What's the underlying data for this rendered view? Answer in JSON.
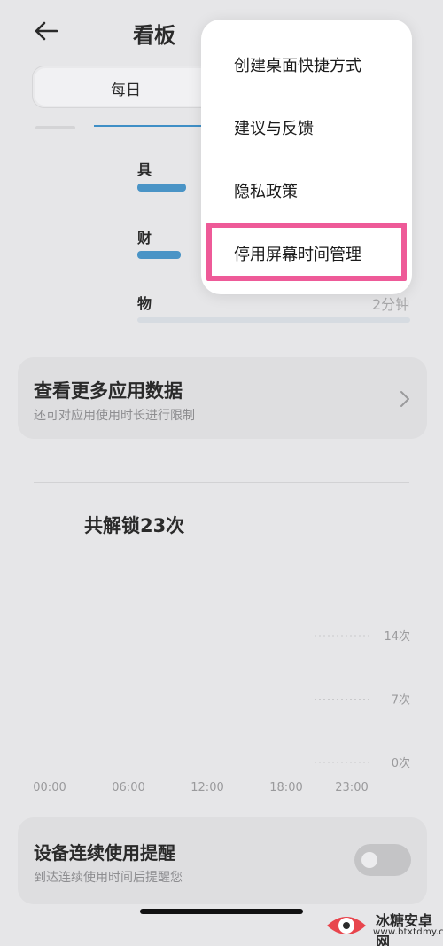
{
  "header": {
    "title": "看板"
  },
  "tabs": {
    "active_label": "每日"
  },
  "apps": [
    {
      "label": "具",
      "bar_fraction": 0.18
    },
    {
      "label": "财",
      "bar_fraction": 0.16
    },
    {
      "label": "物",
      "usage": "2分钟",
      "bar_fraction": 0.01
    }
  ],
  "more_data_card": {
    "title": "查看更多应用数据",
    "subtitle": "还可对应用使用时长进行限制"
  },
  "unlocks": {
    "summary": "共解锁23次"
  },
  "chart_data": {
    "type": "bar",
    "x_ticks": [
      "00:00",
      "06:00",
      "12:00",
      "18:00",
      "23:00"
    ],
    "y_ticks": [
      "14次",
      "7次",
      "0次"
    ],
    "y_tick_values": [
      14,
      7,
      0
    ],
    "ylim": [
      0,
      14
    ],
    "series": [],
    "grid": true
  },
  "reminder_card": {
    "title": "设备连续使用提醒",
    "subtitle": "到达连续使用时间后提醒您",
    "enabled": false
  },
  "menu": {
    "items": [
      "创建桌面快捷方式",
      "建议与反馈",
      "隐私政策",
      "停用屏幕时间管理"
    ],
    "highlighted_index": 3,
    "highlight_color": "#ee5a98"
  },
  "watermark": {
    "name": "冰糖安卓网",
    "url": "www.btxtdmy.com"
  },
  "colors": {
    "accent": "#4a94c6",
    "background": "#e6e6e8",
    "menu_background": "#ffffff"
  }
}
